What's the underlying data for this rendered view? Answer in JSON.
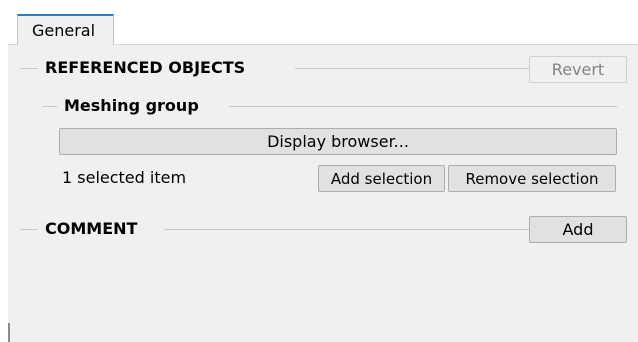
{
  "tabs": [
    {
      "label": "General"
    }
  ],
  "referenced_objects": {
    "title": "REFERENCED OBJECTS",
    "revert_label": "Revert",
    "meshing_group": {
      "title": "Meshing group",
      "display_browser_label": "Display browser...",
      "selection_count": "1 selected item",
      "add_selection_label": "Add selection",
      "remove_selection_label": "Remove selection"
    }
  },
  "comment": {
    "title": "COMMENT",
    "add_label": "Add"
  }
}
